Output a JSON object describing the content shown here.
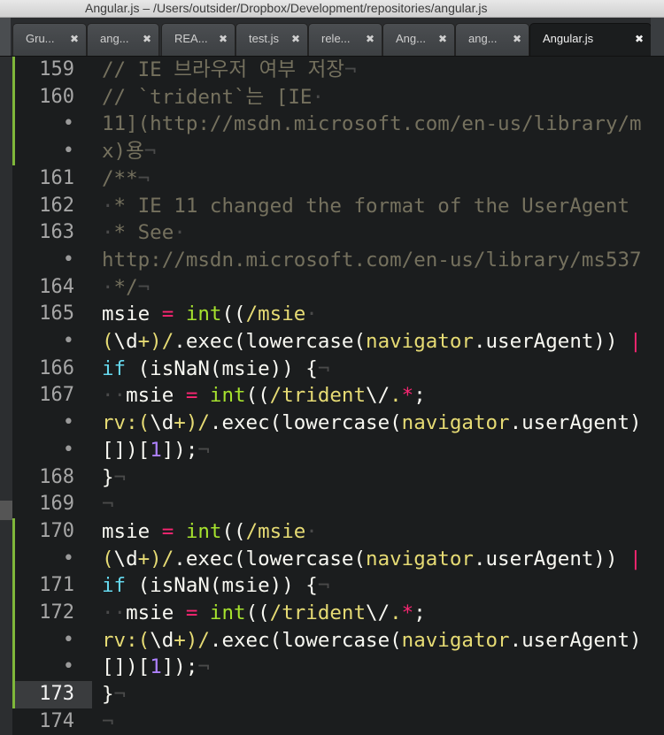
{
  "window": {
    "title": "Angular.js – /Users/outsider/Dropbox/Development/repositories/angular.js"
  },
  "tabs": [
    {
      "label": "Gru...",
      "close": "✖"
    },
    {
      "label": "ang...",
      "close": "✖"
    },
    {
      "label": "REA...",
      "close": "✖"
    },
    {
      "label": "test.js",
      "close": "✖"
    },
    {
      "label": "rele...",
      "close": "✖"
    },
    {
      "label": "Ang...",
      "close": "✖"
    },
    {
      "label": "ang...",
      "close": "✖"
    },
    {
      "label": "Angular.js",
      "close": "✖",
      "active": true
    }
  ],
  "lines": [
    {
      "num": "159",
      "mod": true,
      "tokens": [
        [
          "cm",
          "// IE 브라우저 여부 저장"
        ],
        [
          "ws",
          "¬"
        ]
      ]
    },
    {
      "num": "160",
      "mod": true,
      "tokens": [
        [
          "cm",
          "// `trident`는 [IE"
        ],
        [
          "ws",
          "·"
        ]
      ]
    },
    {
      "num": "•",
      "mod": true,
      "tokens": [
        [
          "cm",
          "11](http://msdn.microsoft.com/en-us/library/m"
        ]
      ]
    },
    {
      "num": "•",
      "mod": true,
      "tokens": [
        [
          "cm",
          "x)용"
        ],
        [
          "ws",
          "¬"
        ]
      ]
    },
    {
      "num": "161",
      "tokens": [
        [
          "cm",
          "/**"
        ],
        [
          "ws",
          "¬"
        ]
      ]
    },
    {
      "num": "162",
      "tokens": [
        [
          "ws",
          "·"
        ],
        [
          "cm",
          "* IE 11 changed the format of the UserAgent"
        ]
      ]
    },
    {
      "num": "163",
      "tokens": [
        [
          "ws",
          "·"
        ],
        [
          "cm",
          "* See"
        ],
        [
          "ws",
          "·"
        ]
      ]
    },
    {
      "num": "•",
      "tokens": [
        [
          "cm",
          "http://msdn.microsoft.com/en-us/library/ms537"
        ]
      ]
    },
    {
      "num": "164",
      "tokens": [
        [
          "ws",
          "·"
        ],
        [
          "cm",
          "*/"
        ],
        [
          "ws",
          "¬"
        ]
      ]
    },
    {
      "num": "165",
      "tokens": [
        [
          "",
          "msie "
        ],
        [
          "op",
          "="
        ],
        [
          "",
          ""
        ],
        [
          "fn",
          " int"
        ],
        [
          "",
          "(("
        ],
        [
          "re",
          "/msie"
        ],
        [
          "ws",
          "·"
        ]
      ]
    },
    {
      "num": "•",
      "tokens": [
        [
          "re",
          "("
        ],
        [
          "",
          "\\d"
        ],
        [
          "re",
          "+)"
        ],
        [
          "re",
          "/"
        ],
        [
          "",
          ".exec(lowercase("
        ],
        [
          "re",
          "navigator"
        ],
        [
          "",
          ".userAgent)) "
        ],
        [
          "op",
          "|"
        ]
      ]
    },
    {
      "num": "166",
      "tokens": [
        [
          "kw",
          "if"
        ],
        [
          "",
          ""
        ],
        [
          "",
          " (isNaN(msie)) {"
        ],
        [
          "ws",
          "¬"
        ]
      ]
    },
    {
      "num": "167",
      "tokens": [
        [
          "ws",
          "··"
        ],
        [
          "",
          "msie "
        ],
        [
          "op",
          "="
        ],
        [
          "fn",
          " int"
        ],
        [
          "",
          "(("
        ],
        [
          "re",
          "/trident"
        ],
        [
          "",
          "\\/"
        ],
        [
          "re",
          "."
        ],
        [
          "op",
          "*"
        ],
        [
          "",
          ";"
        ]
      ]
    },
    {
      "num": "•",
      "tokens": [
        [
          "re",
          "rv:("
        ],
        [
          "",
          "\\d"
        ],
        [
          "re",
          "+)"
        ],
        [
          "re",
          "/"
        ],
        [
          "",
          ".exec(lowercase("
        ],
        [
          "re",
          "navigator"
        ],
        [
          "",
          ".userAgent)"
        ]
      ]
    },
    {
      "num": "•",
      "tokens": [
        [
          "",
          "[])["
        ],
        [
          "num",
          "1"
        ],
        [
          "",
          "]);"
        ],
        [
          "ws",
          "¬"
        ]
      ]
    },
    {
      "num": "168",
      "tokens": [
        [
          "",
          "}"
        ],
        [
          "ws",
          "¬"
        ]
      ]
    },
    {
      "num": "169",
      "tokens": [
        [
          "ws",
          "¬"
        ]
      ]
    },
    {
      "num": "170",
      "mod": true,
      "tokens": [
        [
          "",
          "msie "
        ],
        [
          "op",
          "="
        ],
        [
          "fn",
          " int"
        ],
        [
          "",
          "(("
        ],
        [
          "re",
          "/msie"
        ],
        [
          "ws",
          "·"
        ]
      ]
    },
    {
      "num": "•",
      "mod": true,
      "tokens": [
        [
          "re",
          "("
        ],
        [
          "",
          "\\d"
        ],
        [
          "re",
          "+)"
        ],
        [
          "re",
          "/"
        ],
        [
          "",
          ".exec(lowercase("
        ],
        [
          "re",
          "navigator"
        ],
        [
          "",
          ".userAgent)) "
        ],
        [
          "op",
          "|"
        ]
      ]
    },
    {
      "num": "171",
      "mod": true,
      "tokens": [
        [
          "kw",
          "if"
        ],
        [
          "",
          " (isNaN(msie)) {"
        ],
        [
          "ws",
          "¬"
        ]
      ]
    },
    {
      "num": "172",
      "mod": true,
      "tokens": [
        [
          "ws",
          "··"
        ],
        [
          "",
          "msie "
        ],
        [
          "op",
          "="
        ],
        [
          "fn",
          " int"
        ],
        [
          "",
          "(("
        ],
        [
          "re",
          "/trident"
        ],
        [
          "",
          "\\/"
        ],
        [
          "re",
          "."
        ],
        [
          "op",
          "*"
        ],
        [
          "",
          ";"
        ]
      ]
    },
    {
      "num": "•",
      "mod": true,
      "tokens": [
        [
          "re",
          "rv:("
        ],
        [
          "",
          "\\d"
        ],
        [
          "re",
          "+)"
        ],
        [
          "re",
          "/"
        ],
        [
          "",
          ".exec(lowercase("
        ],
        [
          "re",
          "navigator"
        ],
        [
          "",
          ".userAgent)"
        ]
      ]
    },
    {
      "num": "•",
      "mod": true,
      "tokens": [
        [
          "",
          "[])["
        ],
        [
          "num",
          "1"
        ],
        [
          "",
          "]);"
        ],
        [
          "ws",
          "¬"
        ]
      ]
    },
    {
      "num": "173",
      "mod": true,
      "current": true,
      "tokens": [
        [
          "",
          "}"
        ],
        [
          "ws",
          "¬"
        ]
      ]
    },
    {
      "num": "174",
      "tokens": [
        [
          "ws",
          "¬"
        ]
      ]
    }
  ]
}
